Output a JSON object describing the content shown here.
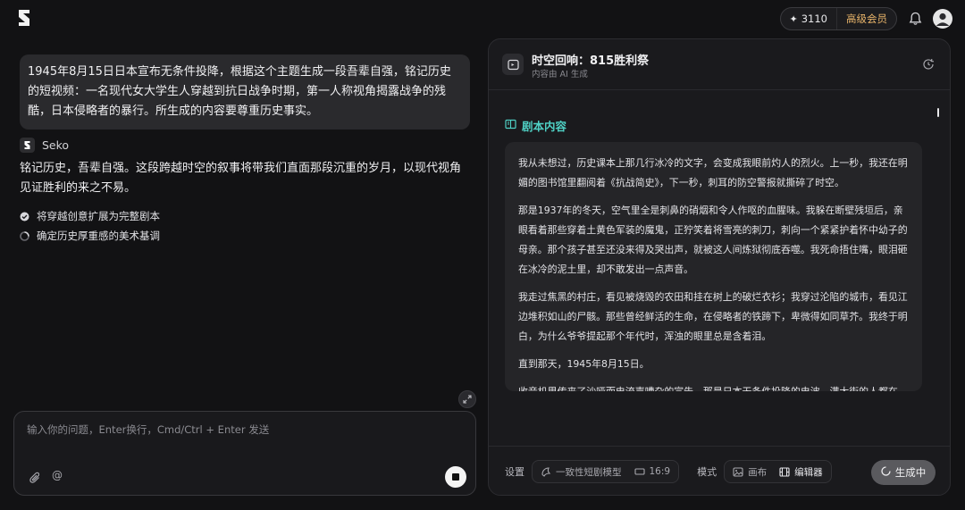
{
  "app": {
    "logo_glyph": "S"
  },
  "topbar": {
    "credits_count": "3110",
    "credits_icon": "sparkle-icon",
    "membership_label": "高级会员"
  },
  "chat": {
    "user_message": "1945年8月15日日本宣布无条件投降，根据这个主题生成一段吾辈自强，铭记历史的短视频：一名现代女大学生人穿越到抗日战争时期，第一人称视角揭露战争的残酷，日本侵略者的暴行。所生成的内容要尊重历史事实。",
    "agent_name": "Seko",
    "agent_message": "铭记历史，吾辈自强。这段跨越时空的叙事将带我们直面那段沉重的岁月，以现代视角见证胜利的来之不易。",
    "steps": [
      {
        "label": "将穿越创意扩展为完整剧本",
        "status": "done"
      },
      {
        "label": "确定历史厚重感的美术基调",
        "status": "in-progress"
      }
    ],
    "input_placeholder": "输入你的问题，Enter换行，Cmd/Ctrl + Enter 发送",
    "input_value": "",
    "mention_symbol": "@"
  },
  "panel": {
    "title": "时空回响：815胜利祭",
    "subtitle": "内容由 AI 生成",
    "section_label": "剧本内容",
    "paragraphs": [
      "我从未想过，历史课本上那几行冰冷的文字，会变成我眼前灼人的烈火。上一秒，我还在明媚的图书馆里翻阅着《抗战简史》，下一秒，刺耳的防空警报就撕碎了时空。",
      "那是1937年的冬天，空气里全是刺鼻的硝烟和令人作呕的血腥味。我躲在断壁残垣后，亲眼看着那些穿着土黄色军装的魔鬼，正狞笑着将雪亮的刺刀，刺向一个紧紧护着怀中幼子的母亲。那个孩子甚至还没来得及哭出声，就被这人间炼狱彻底吞噬。我死命捂住嘴，眼泪砸在冰冷的泥土里，却不敢发出一点声音。",
      "我走过焦黑的村庄，看见被烧毁的农田和挂在树上的破烂衣衫；我穿过沦陷的城市，看见江边堆积如山的尸骸。那些曾经鲜活的生命，在侵略者的铁蹄下，卑微得如同草芥。我终于明白，为什么爷爷提起那个年代时，浑浊的眼里总是含着泪。",
      "直到那天，1945年8月15日。",
      "收音机里传来了沙哑而电流声嘈杂的宣告，那是日本无条件投降的电波。满大街的人都在"
    ],
    "footer": {
      "settings_label": "设置",
      "model_label": "一致性短剧模型",
      "ratio_label": "16:9",
      "mode_label": "模式",
      "canvas_label": "画布",
      "editor_label": "编辑器",
      "generate_label": "生成中"
    }
  },
  "colors": {
    "accent_teal": "#4fd1c5",
    "member_gold": "#e8b46a",
    "background": "#121214",
    "panel": "#1a1a1d"
  }
}
